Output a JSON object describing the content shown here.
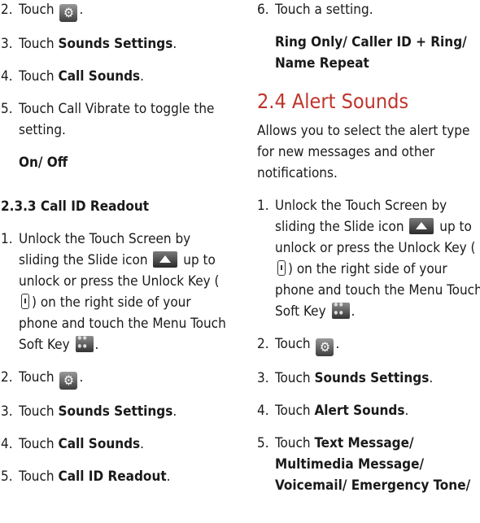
{
  "left": {
    "s1": {
      "num": "2.",
      "a": "Touch",
      "b": "."
    },
    "s2": {
      "num": "3.",
      "a": "Touch ",
      "bold": "Sounds Settings",
      "c": "."
    },
    "s3": {
      "num": "4.",
      "a": "Touch ",
      "bold": "Call Sounds",
      "c": "."
    },
    "s4": {
      "num": "5.",
      "text": "Touch Call Vibrate to toggle the setting."
    },
    "options": "On/ Off",
    "heading": "2.3.3 Call ID Readout",
    "s5": {
      "num": "1.",
      "t1": "Unlock the Touch Screen by sliding the Slide icon",
      "t2": "up to unlock or press the Unlock Key (",
      "t3": ") on the right side of your phone and touch the Menu Touch Soft Key",
      "t4": "."
    },
    "s6": {
      "num": "2.",
      "a": "Touch",
      "b": "."
    },
    "s7": {
      "num": "3.",
      "a": "Touch ",
      "bold": "Sounds Settings",
      "c": "."
    },
    "s8": {
      "num": "4.",
      "a": "Touch ",
      "bold": "Call Sounds",
      "c": "."
    },
    "s9": {
      "num": "5.",
      "a": "Touch ",
      "bold": "Call ID Readout",
      "c": "."
    }
  },
  "right": {
    "s1": {
      "num": "6.",
      "text": "Touch a setting."
    },
    "options": "Ring Only/ Caller ID + Ring/ Name Repeat",
    "section_title": "2.4 Alert Sounds",
    "intro": "Allows you to select the alert type for new messages and other notifications.",
    "s2": {
      "num": "1.",
      "t1": "Unlock the Touch Screen by sliding the Slide icon",
      "t2": "up to unlock or press the Unlock Key (",
      "t3": ") on the right side of your phone and touch the Menu Touch Soft Key",
      "t4": "."
    },
    "s3": {
      "num": "2.",
      "a": "Touch",
      "b": "."
    },
    "s4": {
      "num": "3.",
      "a": "Touch ",
      "bold": "Sounds Settings",
      "c": "."
    },
    "s5": {
      "num": "4.",
      "a": "Touch ",
      "bold": "Alert Sounds",
      "c": "."
    },
    "s6": {
      "num": "5.",
      "a": "Touch ",
      "bold": "Text Message/ Multimedia Message/ Voicemail/ Emergency Tone/"
    }
  },
  "icons": {
    "gear": "settings-gear-icon",
    "slide": "slide-up-icon",
    "unlock": "unlock-key-icon",
    "menu": "menu-soft-key-icon"
  },
  "colors": {
    "heading_red": "#c0342c",
    "text": "#1a1a1a"
  }
}
